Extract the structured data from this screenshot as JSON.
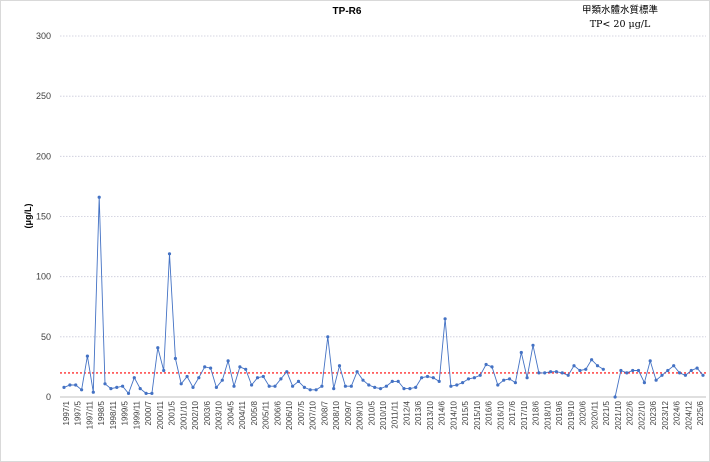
{
  "chart_data": {
    "type": "line",
    "title": "TP-R6",
    "ylabel": "(μg/L)",
    "xlabel": "",
    "ylim": [
      0,
      300
    ],
    "yticks": [
      0,
      50,
      100,
      150,
      200,
      250,
      300
    ],
    "grid": "horizontal-dotted",
    "standard_legend": [
      "甲類水體水質標準",
      "TP< 20 μg/L"
    ],
    "standard_value": 20,
    "standard_color": "#ff0000",
    "series_color": "#4472c4",
    "x_tick_labels": [
      "1997/1",
      "1997/5",
      "1997/11",
      "1998/5",
      "1998/11",
      "1999/5",
      "1999/11",
      "2000/7",
      "2000/11",
      "2001/5",
      "2001/10",
      "2002/10",
      "2003/6",
      "2003/10",
      "2004/5",
      "2004/11",
      "2005/8",
      "2005/11",
      "2006/6",
      "2006/10",
      "2007/5",
      "2007/10",
      "2008/7",
      "2008/10",
      "2009/7",
      "2009/10",
      "2010/5",
      "2010/10",
      "2011/11",
      "2012/4",
      "2013/6",
      "2013/10",
      "2014/6",
      "2014/10",
      "2015/5",
      "2015/10",
      "2016/6",
      "2016/10",
      "2017/6",
      "2017/10",
      "2018/6",
      "2018/10",
      "2019/6",
      "2019/10",
      "2020/6",
      "2020/11",
      "2021/5",
      "2021/10",
      "2022/6",
      "2022/10",
      "2023/6",
      "2023/12",
      "2024/6",
      "2024/12",
      "2025/6"
    ],
    "series": [
      {
        "values": [
          8,
          10,
          10,
          6,
          34,
          4,
          166,
          11,
          7,
          8,
          9,
          3,
          16,
          7,
          3,
          3,
          41,
          22,
          119,
          32,
          11,
          17,
          8,
          16,
          25,
          24,
          8,
          14,
          30,
          9,
          25,
          23,
          10,
          16,
          17,
          9,
          9,
          15,
          21,
          9,
          13,
          8,
          6,
          6,
          9,
          50,
          7,
          26,
          9,
          9,
          21,
          14,
          10,
          8,
          7,
          9,
          13,
          13,
          7,
          7,
          8,
          16,
          17,
          16,
          13,
          65,
          9,
          10,
          12,
          15,
          16,
          18,
          27,
          25,
          10,
          14,
          15,
          12,
          37,
          16,
          43,
          20,
          20,
          21,
          21,
          20,
          18,
          26,
          22,
          23,
          31,
          26,
          23,
          null,
          0,
          22,
          20,
          22,
          22,
          12,
          30,
          14,
          18,
          22,
          26,
          20,
          18,
          22,
          24,
          18
        ]
      }
    ]
  }
}
